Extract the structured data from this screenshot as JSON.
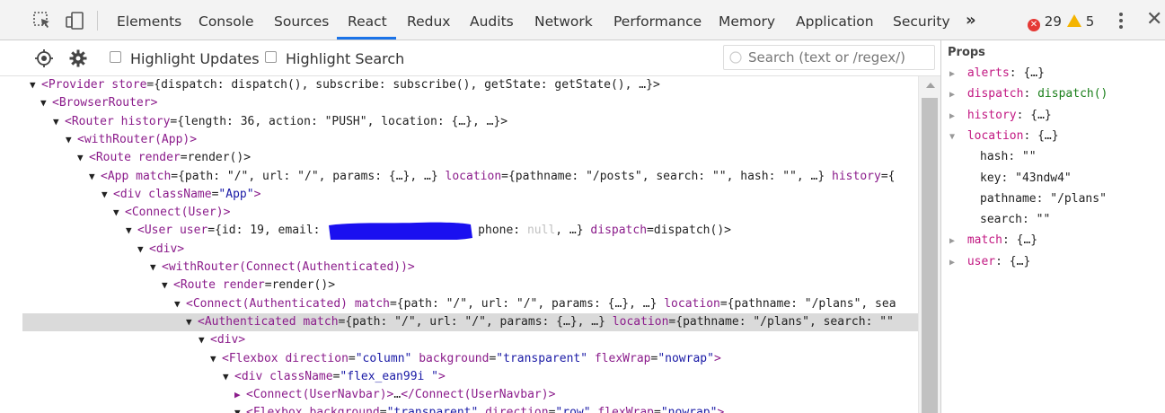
{
  "tabs": [
    "Elements",
    "Console",
    "Sources",
    "React",
    "Redux",
    "Audits",
    "Network",
    "Performance",
    "Memory",
    "Application",
    "Security"
  ],
  "active_tab": "React",
  "more_tabs_label": "»",
  "error_count": "29",
  "warning_count": "5",
  "toolbar": {
    "highlight_updates_label": "Highlight Updates",
    "highlight_search_label": "Highlight Search",
    "search_placeholder": "Search (text or /regex/)"
  },
  "tree": {
    "rows": [
      {
        "segments": [
          [
            "tri",
            "▼"
          ],
          [
            "tag",
            "<Provider "
          ],
          [
            "attr",
            "store"
          ],
          [
            "plain",
            "={dispatch: dispatch(), subscribe: subscribe(), getState: getState(), …}>"
          ]
        ]
      },
      {
        "segments": [
          [
            "tri",
            "▼"
          ],
          [
            "tag",
            "<BrowserRouter>"
          ]
        ]
      },
      {
        "segments": [
          [
            "tri",
            "▼"
          ],
          [
            "tag",
            "<Router "
          ],
          [
            "attr",
            "history"
          ],
          [
            "plain",
            "={length: 36, action: \"PUSH\", location: {…}, …}>"
          ]
        ]
      },
      {
        "segments": [
          [
            "tri",
            "▼"
          ],
          [
            "tag",
            "<withRouter(App)>"
          ]
        ]
      },
      {
        "segments": [
          [
            "tri",
            "▼"
          ],
          [
            "tag",
            "<Route "
          ],
          [
            "attr",
            "render"
          ],
          [
            "plain",
            "=render()>"
          ]
        ]
      },
      {
        "segments": [
          [
            "tri",
            "▼"
          ],
          [
            "tag",
            "<App "
          ],
          [
            "attr",
            "match"
          ],
          [
            "plain",
            "={path: \"/\", url: \"/\", params: {…}, …} "
          ],
          [
            "attr",
            "location"
          ],
          [
            "plain",
            "={pathname: \"/posts\", search: \"\", hash: \"\", …} "
          ],
          [
            "attr",
            "history"
          ],
          [
            "plain",
            "={"
          ]
        ]
      },
      {
        "segments": [
          [
            "tri",
            "▼"
          ],
          [
            "tag",
            "<div "
          ],
          [
            "attr",
            "className"
          ],
          [
            "plain",
            "="
          ],
          [
            "val",
            "\"App\""
          ],
          [
            "tag",
            ">"
          ]
        ]
      },
      {
        "segments": [
          [
            "tri",
            "▼"
          ],
          [
            "tag",
            "<Connect(User)>"
          ]
        ]
      },
      {
        "segments": [
          [
            "tri",
            "▼"
          ],
          [
            "tag",
            "<User "
          ],
          [
            "attr",
            "user"
          ],
          [
            "plain",
            "={id: 19, email: "
          ],
          [
            "redact",
            ""
          ],
          [
            "plain",
            " phone: "
          ],
          [
            "muted",
            "null"
          ],
          [
            "plain",
            ", …} "
          ],
          [
            "attr",
            "dispatch"
          ],
          [
            "plain",
            "=dispatch()>"
          ]
        ]
      },
      {
        "segments": [
          [
            "tri",
            "▼"
          ],
          [
            "tag",
            "<div>"
          ]
        ]
      },
      {
        "segments": [
          [
            "tri",
            "▼"
          ],
          [
            "tag",
            "<withRouter(Connect(Authenticated))>"
          ]
        ]
      },
      {
        "segments": [
          [
            "tri",
            "▼"
          ],
          [
            "tag",
            "<Route "
          ],
          [
            "attr",
            "render"
          ],
          [
            "plain",
            "=render()>"
          ]
        ]
      },
      {
        "segments": [
          [
            "tri",
            "▼"
          ],
          [
            "tag",
            "<Connect(Authenticated) "
          ],
          [
            "attr",
            "match"
          ],
          [
            "plain",
            "={path: \"/\", url: \"/\", params: {…}, …} "
          ],
          [
            "attr",
            "location"
          ],
          [
            "plain",
            "={pathname: \"/plans\", sea"
          ]
        ]
      },
      {
        "segments": [
          [
            "tri",
            "▼"
          ],
          [
            "tag",
            "<Authenticated "
          ],
          [
            "attr",
            "match"
          ],
          [
            "plain",
            "={path: \"/\", url: \"/\", params: {…}, …} "
          ],
          [
            "attr",
            "location"
          ],
          [
            "plain",
            "={pathname: \"/plans\", search: \"\""
          ]
        ]
      },
      {
        "segments": [
          [
            "tri",
            "▼"
          ],
          [
            "tag",
            "<div>"
          ]
        ]
      },
      {
        "segments": [
          [
            "tri",
            "▼"
          ],
          [
            "tag",
            "<Flexbox "
          ],
          [
            "attr",
            "direction"
          ],
          [
            "plain",
            "="
          ],
          [
            "val",
            "\"column\""
          ],
          [
            "plain",
            " "
          ],
          [
            "attr",
            "background"
          ],
          [
            "plain",
            "="
          ],
          [
            "val",
            "\"transparent\""
          ],
          [
            "plain",
            " "
          ],
          [
            "attr",
            "flexWrap"
          ],
          [
            "plain",
            "="
          ],
          [
            "val",
            "\"nowrap\""
          ],
          [
            "tag",
            ">"
          ]
        ]
      },
      {
        "segments": [
          [
            "tri",
            "▼"
          ],
          [
            "tag",
            "<div "
          ],
          [
            "attr",
            "className"
          ],
          [
            "plain",
            "="
          ],
          [
            "val",
            "\"flex_ean99i \""
          ],
          [
            "tag",
            ">"
          ]
        ]
      },
      {
        "segments": [
          [
            "tri-c",
            "▶"
          ],
          [
            "tag",
            "<Connect(UserNavbar)>"
          ],
          [
            "plain",
            "…"
          ],
          [
            "tag",
            "</Connect(UserNavbar)>"
          ]
        ]
      },
      {
        "segments": [
          [
            "tri",
            "▼"
          ],
          [
            "tag",
            "<Flexbox "
          ],
          [
            "attr",
            "background"
          ],
          [
            "plain",
            "="
          ],
          [
            "val",
            "\"transparent\""
          ],
          [
            "plain",
            " "
          ],
          [
            "attr",
            "direction"
          ],
          [
            "plain",
            "="
          ],
          [
            "val",
            "\"row\""
          ],
          [
            "plain",
            " "
          ],
          [
            "attr",
            "flexWrap"
          ],
          [
            "plain",
            "="
          ],
          [
            "val",
            "\"nowrap\""
          ],
          [
            "tag",
            ">"
          ]
        ]
      }
    ]
  },
  "props": {
    "title": "Props",
    "items": [
      {
        "tri": "▶",
        "key": "alerts",
        "value": "{…}",
        "kind": "val"
      },
      {
        "tri": "▶",
        "key": "dispatch",
        "value": "dispatch()",
        "kind": "fn"
      },
      {
        "tri": "▶",
        "key": "history",
        "value": "{…}",
        "kind": "val"
      },
      {
        "tri": "▼",
        "key": "location",
        "value": "{…}",
        "kind": "val"
      },
      {
        "tri": "",
        "key": "hash",
        "value": "\"\"",
        "kind": "sub"
      },
      {
        "tri": "",
        "key": "key",
        "value": "\"43ndw4\"",
        "kind": "sub"
      },
      {
        "tri": "",
        "key": "pathname",
        "value": "\"/plans\"",
        "kind": "sub"
      },
      {
        "tri": "",
        "key": "search",
        "value": "\"\"",
        "kind": "sub"
      },
      {
        "tri": "▶",
        "key": "match",
        "value": "{…}",
        "kind": "val"
      },
      {
        "tri": "▶",
        "key": "user",
        "value": "{…}",
        "kind": "val"
      }
    ]
  },
  "colors": {
    "accent": "#1a73e8",
    "tag": "#8b1c8b",
    "attr_value": "#1a1aa6",
    "prop_key": "#c21882",
    "fn_value": "#1a7f1a",
    "error": "#e53935",
    "warning": "#f4b400",
    "redaction": "#1a10f0"
  }
}
